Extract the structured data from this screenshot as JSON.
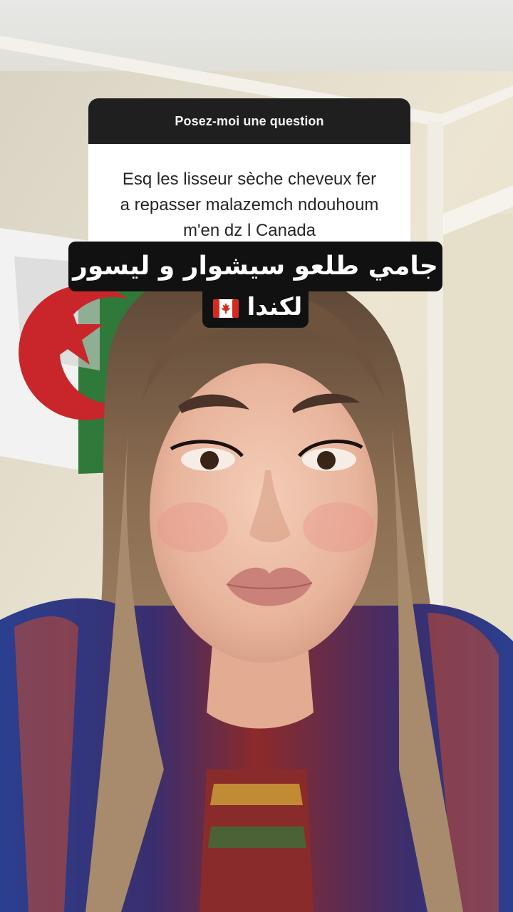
{
  "question_sticker": {
    "header": "Posez-moi une question",
    "lines": [
      "Esq les lisseur sèche cheveux fer",
      "a repasser malazemch ndouhoum",
      "m'en dz l Canada"
    ]
  },
  "caption": {
    "line1": "جامي طلعو سيشوار و ليسور",
    "line2": "لكندا",
    "flag_icon": "canada-flag-icon"
  },
  "colors": {
    "header_bg": "#1f1f1f",
    "caption_bg": "#111111",
    "wall": "#e9e2cf"
  }
}
